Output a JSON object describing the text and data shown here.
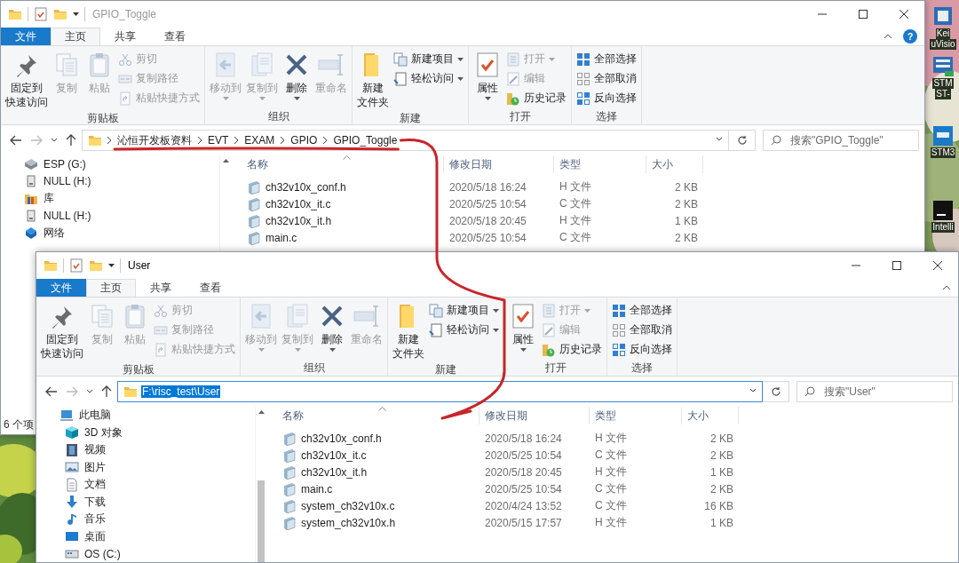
{
  "desktop_icons": [
    {
      "lines": [
        "Kei",
        "uVisio"
      ]
    },
    {
      "lines": [
        "STM",
        "ST-"
      ]
    },
    {
      "lines": [
        "STM3"
      ]
    },
    {
      "lines": [
        "Intelli"
      ]
    }
  ],
  "windows": [
    {
      "title": "GPIO_Toggle",
      "active": false,
      "help": "?",
      "tabs": [
        {
          "label": "文件",
          "kind": "menu",
          "selected": false
        },
        {
          "label": "主页",
          "kind": "tab",
          "selected": true
        },
        {
          "label": "共享",
          "kind": "tab",
          "selected": false
        },
        {
          "label": "查看",
          "kind": "tab",
          "selected": false
        }
      ],
      "ribbon": [
        {
          "label": "剪贴板",
          "buttons": [
            {
              "kind": "large",
              "lines": [
                "固定到",
                "快速访问"
              ],
              "disabled": false,
              "dropdown": false
            },
            {
              "kind": "large",
              "lines": [
                "复制"
              ],
              "disabled": true,
              "dropdown": false
            },
            {
              "kind": "large",
              "lines": [
                "粘贴"
              ],
              "disabled": true,
              "dropdown": false
            },
            {
              "kind": "small",
              "lines": [
                "剪切"
              ],
              "disabled": true,
              "dropdown": false
            },
            {
              "kind": "small",
              "lines": [
                "复制路径"
              ],
              "disabled": true,
              "dropdown": false
            },
            {
              "kind": "small",
              "lines": [
                "粘贴快捷方式"
              ],
              "disabled": true,
              "dropdown": false
            }
          ]
        },
        {
          "label": "组织",
          "buttons": [
            {
              "kind": "large",
              "lines": [
                "移动到"
              ],
              "disabled": true,
              "dropdown": true
            },
            {
              "kind": "large",
              "lines": [
                "复制到"
              ],
              "disabled": true,
              "dropdown": true
            },
            {
              "kind": "large",
              "lines": [
                "删除"
              ],
              "disabled": false,
              "dropdown": true
            },
            {
              "kind": "large",
              "lines": [
                "重命名"
              ],
              "disabled": true,
              "dropdown": false
            }
          ]
        },
        {
          "label": "新建",
          "buttons": [
            {
              "kind": "large",
              "lines": [
                "新建",
                "文件夹"
              ],
              "disabled": false,
              "dropdown": false
            },
            {
              "kind": "small",
              "lines": [
                "新建项目"
              ],
              "disabled": false,
              "dropdown": true
            },
            {
              "kind": "small",
              "lines": [
                "轻松访问"
              ],
              "disabled": false,
              "dropdown": true
            }
          ]
        },
        {
          "label": "打开",
          "buttons": [
            {
              "kind": "large",
              "lines": [
                "属性"
              ],
              "disabled": false,
              "dropdown": true
            },
            {
              "kind": "small",
              "lines": [
                "打开"
              ],
              "disabled": true,
              "dropdown": true
            },
            {
              "kind": "small",
              "lines": [
                "编辑"
              ],
              "disabled": true,
              "dropdown": false
            },
            {
              "kind": "small",
              "lines": [
                "历史记录"
              ],
              "disabled": false,
              "dropdown": false
            }
          ]
        },
        {
          "label": "选择",
          "buttons": [
            {
              "kind": "small",
              "lines": [
                "全部选择"
              ],
              "disabled": false,
              "dropdown": false
            },
            {
              "kind": "small",
              "lines": [
                "全部取消"
              ],
              "disabled": false,
              "dropdown": false
            },
            {
              "kind": "small",
              "lines": [
                "反向选择"
              ],
              "disabled": false,
              "dropdown": false
            }
          ]
        }
      ],
      "address": {
        "kind": "breadcrumb",
        "segments": [
          "沁恒开发板资料",
          "EVT",
          "EXAM",
          "GPIO",
          "GPIO_Toggle"
        ]
      },
      "search": {
        "placeholder": "搜索\"GPIO_Toggle\""
      },
      "nav": [
        {
          "label": "ESP (G:)",
          "kind": "usb"
        },
        {
          "label": "NULL (H:)",
          "kind": "drive"
        },
        {
          "label": "库",
          "kind": "library"
        },
        {
          "label": "NULL (H:)",
          "kind": "drive"
        },
        {
          "label": "网络",
          "kind": "network"
        }
      ],
      "columns": [
        {
          "label": "名称",
          "sorted": true
        },
        {
          "label": "修改日期",
          "sorted": false
        },
        {
          "label": "类型",
          "sorted": false
        },
        {
          "label": "大小",
          "sorted": false
        }
      ],
      "files": [
        {
          "name": "ch32v10x_conf.h",
          "date": "2020/5/18 16:24",
          "type": "H 文件",
          "size": "2 KB"
        },
        {
          "name": "ch32v10x_it.c",
          "date": "2020/5/25 10:54",
          "type": "C 文件",
          "size": "2 KB"
        },
        {
          "name": "ch32v10x_it.h",
          "date": "2020/5/18 20:45",
          "type": "H 文件",
          "size": "1 KB"
        },
        {
          "name": "main.c",
          "date": "2020/5/25 10:54",
          "type": "C 文件",
          "size": "2 KB"
        }
      ],
      "status": "6 个项"
    },
    {
      "title": "User",
      "active": true,
      "tabs": [
        {
          "label": "文件",
          "kind": "menu",
          "selected": false
        },
        {
          "label": "主页",
          "kind": "tab",
          "selected": true
        },
        {
          "label": "共享",
          "kind": "tab",
          "selected": false
        },
        {
          "label": "查看",
          "kind": "tab",
          "selected": false
        }
      ],
      "ribbon": [
        {
          "label": "剪贴板",
          "buttons": [
            {
              "kind": "large",
              "lines": [
                "固定到",
                "快速访问"
              ],
              "disabled": false,
              "dropdown": false
            },
            {
              "kind": "large",
              "lines": [
                "复制"
              ],
              "disabled": true,
              "dropdown": false
            },
            {
              "kind": "large",
              "lines": [
                "粘贴"
              ],
              "disabled": true,
              "dropdown": false
            },
            {
              "kind": "small",
              "lines": [
                "剪切"
              ],
              "disabled": true,
              "dropdown": false
            },
            {
              "kind": "small",
              "lines": [
                "复制路径"
              ],
              "disabled": true,
              "dropdown": false
            },
            {
              "kind": "small",
              "lines": [
                "粘贴快捷方式"
              ],
              "disabled": true,
              "dropdown": false
            }
          ]
        },
        {
          "label": "组织",
          "buttons": [
            {
              "kind": "large",
              "lines": [
                "移动到"
              ],
              "disabled": true,
              "dropdown": true
            },
            {
              "kind": "large",
              "lines": [
                "复制到"
              ],
              "disabled": true,
              "dropdown": true
            },
            {
              "kind": "large",
              "lines": [
                "删除"
              ],
              "disabled": false,
              "dropdown": true
            },
            {
              "kind": "large",
              "lines": [
                "重命名"
              ],
              "disabled": true,
              "dropdown": false
            }
          ]
        },
        {
          "label": "新建",
          "buttons": [
            {
              "kind": "large",
              "lines": [
                "新建",
                "文件夹"
              ],
              "disabled": false,
              "dropdown": false
            },
            {
              "kind": "small",
              "lines": [
                "新建项目"
              ],
              "disabled": false,
              "dropdown": true
            },
            {
              "kind": "small",
              "lines": [
                "轻松访问"
              ],
              "disabled": false,
              "dropdown": true
            }
          ]
        },
        {
          "label": "打开",
          "buttons": [
            {
              "kind": "large",
              "lines": [
                "属性"
              ],
              "disabled": false,
              "dropdown": true
            },
            {
              "kind": "small",
              "lines": [
                "打开"
              ],
              "disabled": true,
              "dropdown": true
            },
            {
              "kind": "small",
              "lines": [
                "编辑"
              ],
              "disabled": true,
              "dropdown": false
            },
            {
              "kind": "small",
              "lines": [
                "历史记录"
              ],
              "disabled": false,
              "dropdown": false
            }
          ]
        },
        {
          "label": "选择",
          "buttons": [
            {
              "kind": "small",
              "lines": [
                "全部选择"
              ],
              "disabled": false,
              "dropdown": false
            },
            {
              "kind": "small",
              "lines": [
                "全部取消"
              ],
              "disabled": false,
              "dropdown": false
            },
            {
              "kind": "small",
              "lines": [
                "反向选择"
              ],
              "disabled": false,
              "dropdown": false
            }
          ]
        }
      ],
      "address": {
        "kind": "text",
        "value": "F:\\risc_test\\User",
        "selected": true
      },
      "search": {
        "placeholder": "搜索\"User\""
      },
      "nav": [
        {
          "label": "此电脑",
          "kind": "pc",
          "children": [
            {
              "label": "3D 对象",
              "kind": "cube"
            },
            {
              "label": "视频",
              "kind": "video"
            },
            {
              "label": "图片",
              "kind": "pictures"
            },
            {
              "label": "文档",
              "kind": "docs"
            },
            {
              "label": "下载",
              "kind": "downloads"
            },
            {
              "label": "音乐",
              "kind": "music"
            },
            {
              "label": "桌面",
              "kind": "desktop"
            },
            {
              "label": "OS (C:)",
              "kind": "os"
            }
          ]
        }
      ],
      "columns": [
        {
          "label": "名称",
          "sorted": true
        },
        {
          "label": "修改日期",
          "sorted": false
        },
        {
          "label": "类型",
          "sorted": false
        },
        {
          "label": "大小",
          "sorted": false
        }
      ],
      "files": [
        {
          "name": "ch32v10x_conf.h",
          "date": "2020/5/18 16:24",
          "type": "H 文件",
          "size": "2 KB"
        },
        {
          "name": "ch32v10x_it.c",
          "date": "2020/5/25 10:54",
          "type": "C 文件",
          "size": "2 KB"
        },
        {
          "name": "ch32v10x_it.h",
          "date": "2020/5/18 20:45",
          "type": "H 文件",
          "size": "1 KB"
        },
        {
          "name": "main.c",
          "date": "2020/5/25 10:54",
          "type": "C 文件",
          "size": "2 KB"
        },
        {
          "name": "system_ch32v10x.c",
          "date": "2020/4/24 13:52",
          "type": "C 文件",
          "size": "16 KB"
        },
        {
          "name": "system_ch32v10x.h",
          "date": "2020/5/15 17:57",
          "type": "H 文件",
          "size": "1 KB"
        }
      ]
    }
  ]
}
